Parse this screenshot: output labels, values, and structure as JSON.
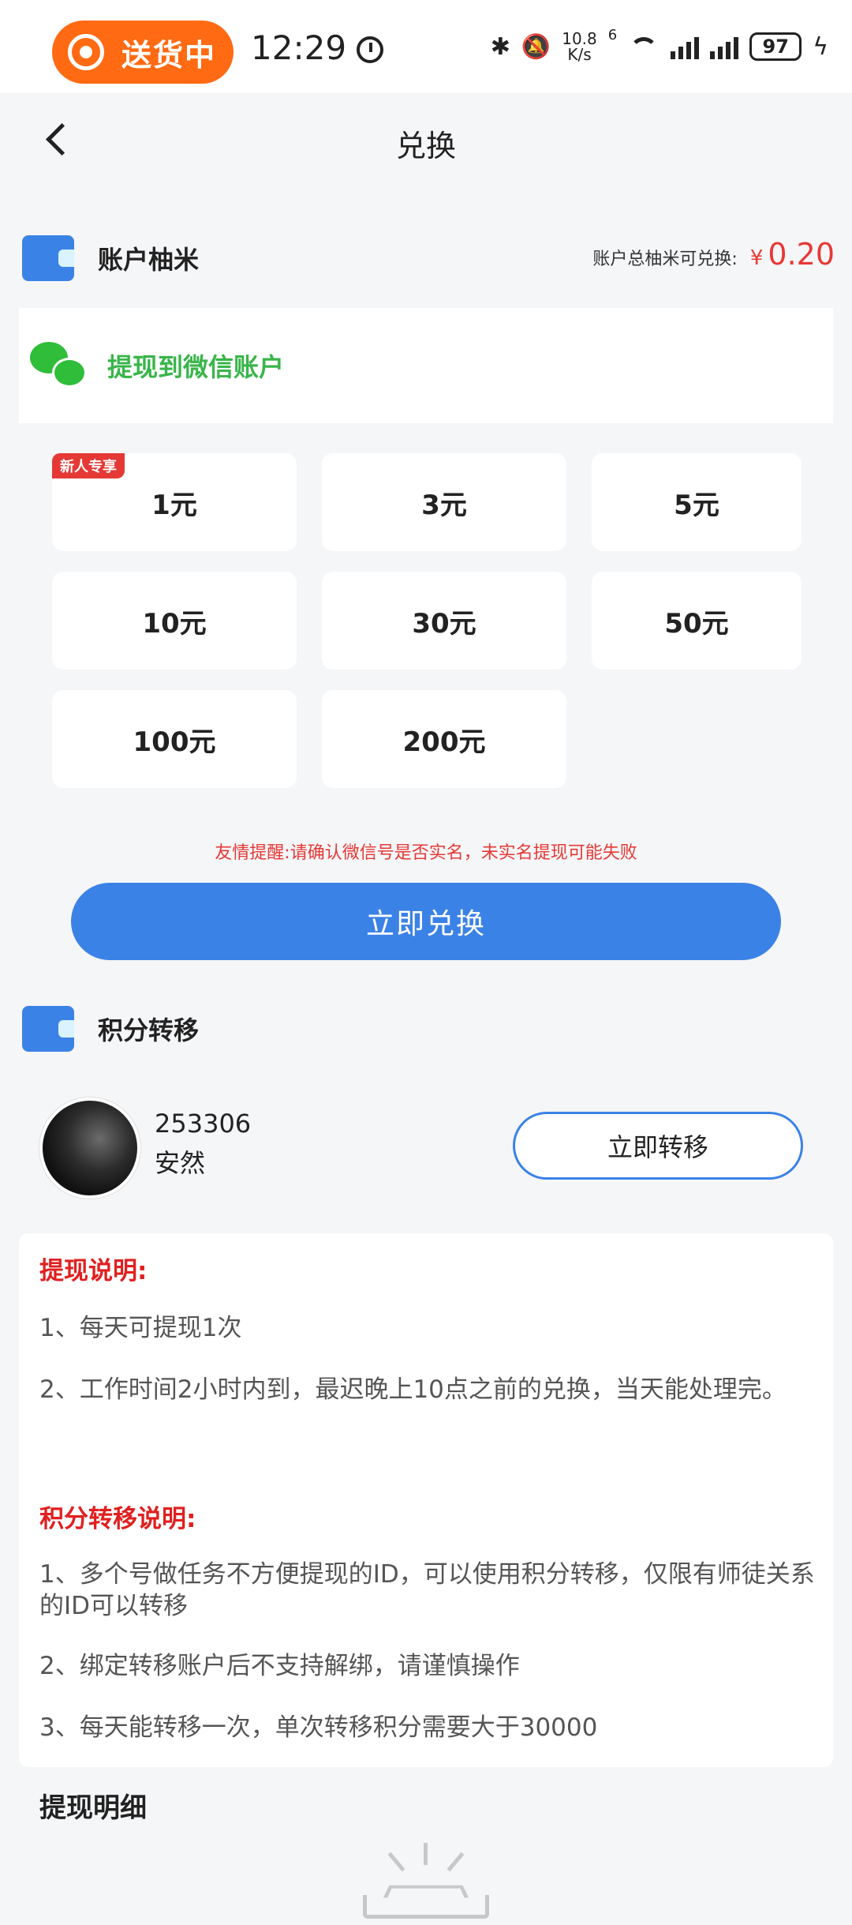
{
  "status_bar": {
    "delivery_label": "送货中",
    "time": "12:29",
    "net_speed_value": "10.8",
    "net_speed_unit": "K/s",
    "network_badge": "6",
    "battery": "97"
  },
  "header": {
    "title": "兑换"
  },
  "account": {
    "title": "账户柚米",
    "balance_label": "账户总柚米可兑换:",
    "currency": "¥",
    "balance": "0.20"
  },
  "withdraw_target": {
    "label": "提现到微信账户"
  },
  "amounts": {
    "new_badge": "新人专享",
    "items": [
      "1元",
      "3元",
      "5元",
      "10元",
      "30元",
      "50元",
      "100元",
      "200元"
    ]
  },
  "notice": "友情提醒:请确认微信号是否实名，未实名提现可能失败",
  "exchange_button": "立即兑换",
  "transfer": {
    "title": "积分转移",
    "user_id": "253306",
    "user_name": "安然",
    "button": "立即转移"
  },
  "instructions": {
    "withdraw_heading": "提现说明:",
    "withdraw_lines": [
      "1、每天可提现1次",
      "2、工作时间2小时内到，最迟晚上10点之前的兑换，当天能处理完。"
    ],
    "transfer_heading": "积分转移说明:",
    "transfer_lines": [
      "1、多个号做任务不方便提现的ID，可以使用积分转移，仅限有师徒关系的ID可以转移",
      "2、绑定转移账户后不支持解绑，请谨慎操作",
      "3、每天能转移一次，单次转移积分需要大于30000"
    ]
  },
  "details": {
    "title": "提现明细"
  },
  "colors": {
    "accent": "#3b82e6",
    "warning": "#e53935",
    "wechat": "#39b54a",
    "delivery": "#ff6a13"
  }
}
